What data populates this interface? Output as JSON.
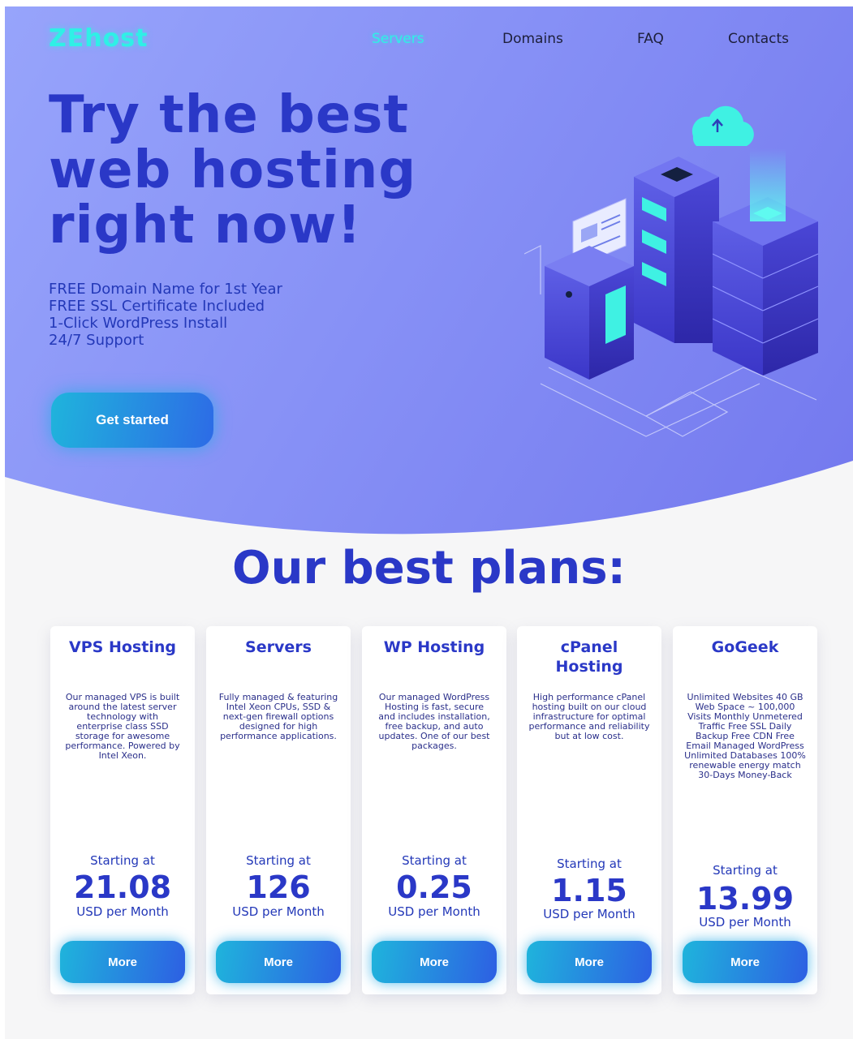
{
  "header": {
    "logo": "ZEhost",
    "nav": [
      {
        "label": "Servers",
        "active": true
      },
      {
        "label": "Domains",
        "active": false
      },
      {
        "label": "FAQ",
        "active": false
      },
      {
        "label": "Contacts",
        "active": false
      }
    ]
  },
  "hero": {
    "headline_line1": "Try the best",
    "headline_line2": "web hosting",
    "headline_line3": "right now!",
    "features": [
      "FREE Domain Name for 1st Year",
      "FREE SSL Certificate Included",
      "1-Click WordPress Install",
      "24/7 Support"
    ],
    "cta_label": "Get started",
    "illustration_icon": "server-stack-cloud-icon"
  },
  "plans": {
    "title": "Our best plans:",
    "starting_label": "Starting at",
    "unit_label": "USD per Month",
    "more_label": "More",
    "items": [
      {
        "name": "VPS Hosting",
        "description": "Our managed VPS is built around the latest server technology with enterprise class SSD storage for awesome performance. Powered by Intel Xeon.",
        "price": "21.08"
      },
      {
        "name": "Servers",
        "description": "Fully managed & featuring Intel Xeon CPUs, SSD & next-gen firewall options designed for high performance applications.",
        "price": "126"
      },
      {
        "name": "WP Hosting",
        "description": "Our managed WordPress Hosting is fast, secure and includes installation, free backup, and auto updates. One of our best packages.",
        "price": "0.25"
      },
      {
        "name": "cPanel Hosting",
        "description": "High performance cPanel hosting built on our cloud infrastructure for optimal performance and reliability but at low cost.",
        "price": "1.15"
      },
      {
        "name": "GoGeek",
        "description": "Unlimited Websites 40 GB Web Space ~ 100,000 Visits Monthly Unmetered Traffic Free SSL Daily Backup Free CDN Free Email Managed WordPress Unlimited Databases 100% renewable energy match 30-Days Money-Back",
        "price": "13.99"
      }
    ]
  },
  "colors": {
    "accent_cyan": "#2ff0e6",
    "brand_blue": "#2a38c7",
    "hero_gradient_start": "#97a4fb",
    "hero_gradient_end": "#7378ee",
    "button_gradient_start": "#1fb4dc",
    "button_gradient_end": "#2d6be6"
  }
}
